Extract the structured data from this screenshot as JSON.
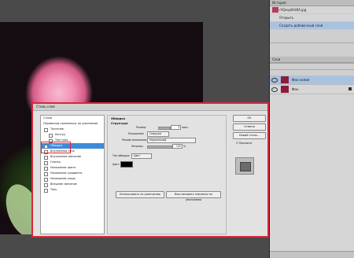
{
  "history": {
    "title": "История",
    "items": [
      {
        "label": "rVQevpKhtKA.jpg"
      },
      {
        "label": "Открыть"
      },
      {
        "label": "Создать добавочный слой"
      }
    ]
  },
  "layers": {
    "title": "Слои",
    "items": [
      {
        "label": "Фон копия"
      },
      {
        "label": "Фон"
      }
    ]
  },
  "dialog": {
    "title": "Стиль слоя",
    "list_header_styles": "Стили",
    "list_header_blend": "Параметры наложения: по умолчанию",
    "items": [
      "Тиснение",
      "Контур",
      "Текстура",
      "Обводка",
      "Внутренняя тень",
      "Внутреннее свечение",
      "Глянец",
      "Наложение цвета",
      "Наложение градиента",
      "Наложение узора",
      "Внешнее свечение",
      "Тень"
    ],
    "section_title": "Обводка",
    "subsection_title": "Структура",
    "size_label": "Размер:",
    "size_value": "3",
    "size_unit": "пикс.",
    "position_label": "Положение:",
    "position_value": "Снаружи",
    "blend_label": "Режим наложения:",
    "blend_value": "Нормальный",
    "opacity_label": "Непрозр.:",
    "opacity_value": "100",
    "opacity_unit": "%",
    "fill_type_label": "Тип обводки:",
    "fill_type_value": "Цвет",
    "color_label": "Цвет:",
    "default_btn": "Использовать по умолчанию",
    "reset_btn": "Восстановить значения по умолчанию",
    "ok_btn": "OK",
    "cancel_btn": "Отмена",
    "new_style_btn": "Новый стиль...",
    "preview_label": "Просмотр"
  },
  "colors": {
    "highlight": "#e0283a",
    "selection": "#3d8bd8"
  }
}
